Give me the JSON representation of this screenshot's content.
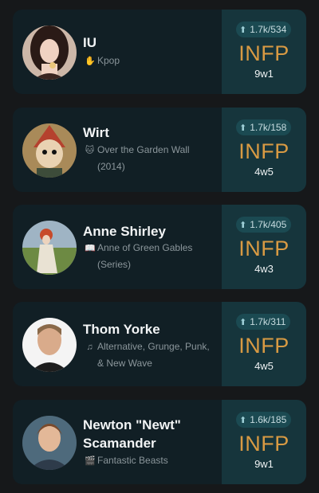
{
  "cards": [
    {
      "name": "IU",
      "category_icon": "hand-icon",
      "category": "Kpop",
      "category_cont": "",
      "votes": "1.7k/534",
      "type": "INFP",
      "wing": "9w1"
    },
    {
      "name": "Wirt",
      "category_icon": "cat-icon",
      "category": "Over the Garden Wall",
      "category_cont": "(2014)",
      "votes": "1.7k/158",
      "type": "INFP",
      "wing": "4w5"
    },
    {
      "name": "Anne Shirley",
      "category_icon": "book-icon",
      "category": "Anne of Green Gables",
      "category_cont": "(Series)",
      "votes": "1.7k/405",
      "type": "INFP",
      "wing": "4w3"
    },
    {
      "name": "Thom Yorke",
      "category_icon": "music-note-icon",
      "category": "Alternative, Grunge, Punk,",
      "category_cont": "& New Wave",
      "votes": "1.7k/311",
      "type": "INFP",
      "wing": "4w5"
    },
    {
      "name": "Newton \"Newt\"",
      "name2": "Scamander",
      "category_icon": "clapperboard-icon",
      "category": "Fantastic Beasts",
      "category_cont": "",
      "votes": "1.6k/185",
      "type": "INFP",
      "wing": "9w1"
    }
  ]
}
